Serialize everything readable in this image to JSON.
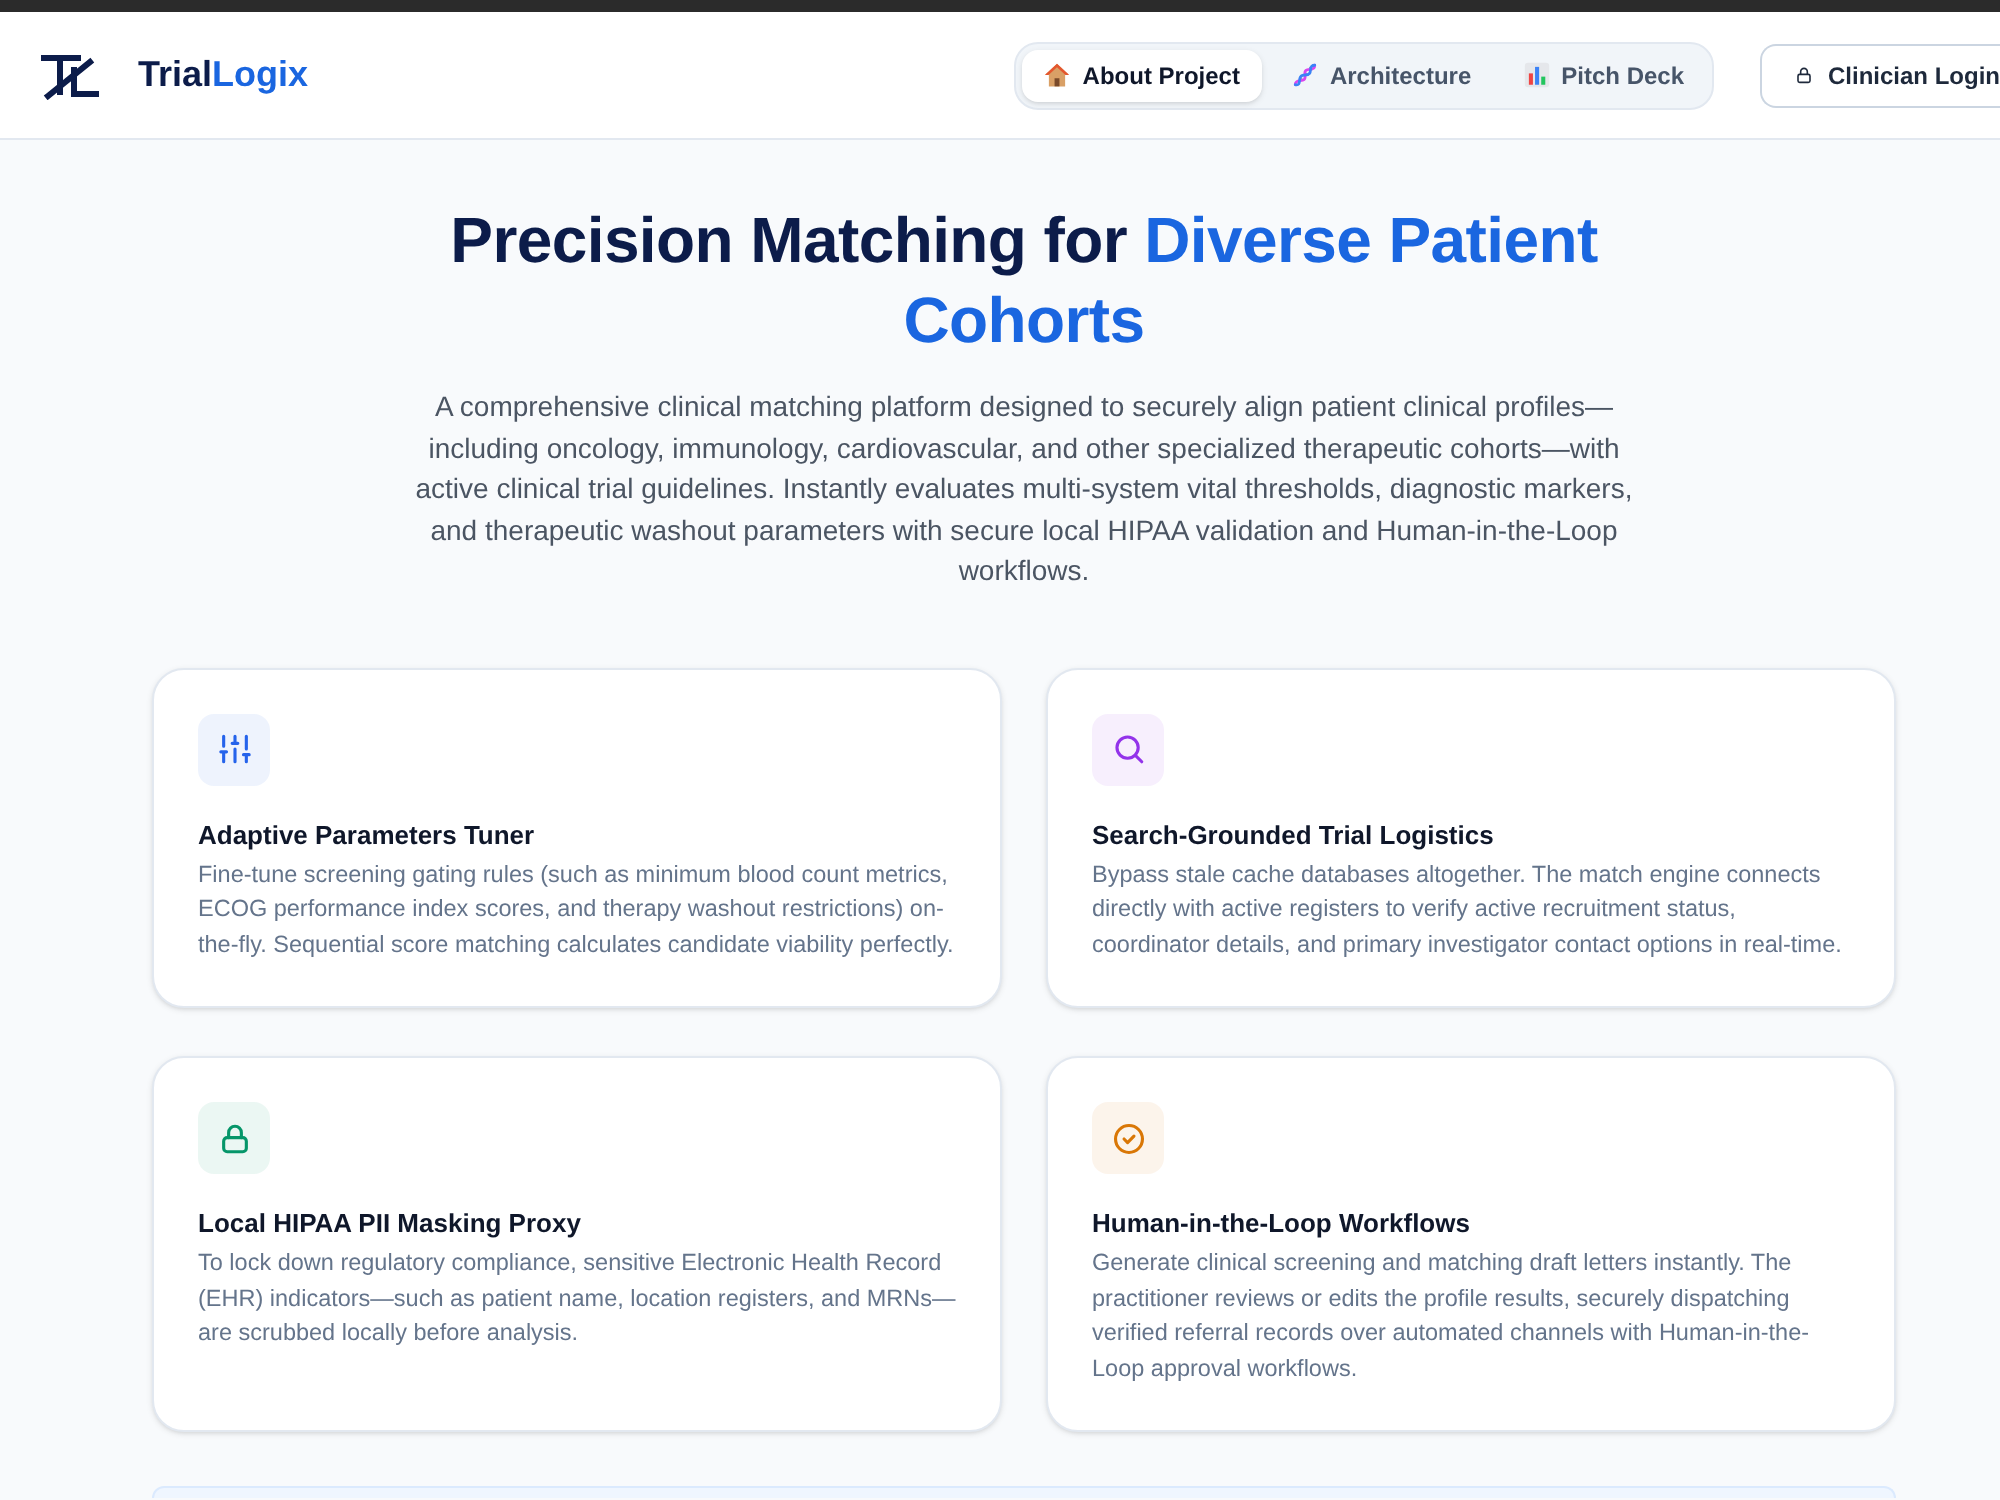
{
  "header": {
    "brand": {
      "text": "Trial",
      "highlight": "Logix"
    },
    "tabs": [
      {
        "label": "About Project",
        "selected": true,
        "kind": "home"
      },
      {
        "label": "Architecture",
        "selected": false,
        "kind": "dna"
      },
      {
        "label": "Pitch Deck",
        "selected": false,
        "kind": "chart"
      }
    ],
    "login_button": {
      "label": "Clinician Login"
    }
  },
  "hero": {
    "title": {
      "text": "Precision Matching for",
      "highlight": "Diverse Patient Cohorts"
    },
    "description": "A comprehensive clinical matching platform designed to securely align patient clinical profiles—including oncology, immunology, cardiovascular, and other specialized therapeutic cohorts—with active clinical trial guidelines. Instantly evaluates multi-system vital thresholds, diagnostic markers, and therapeutic washout parameters with secure local HIPAA validation and Human-in-the-Loop workflows."
  },
  "features": [
    {
      "kind": "tuner",
      "color": "#2563eb",
      "title": "Adaptive Parameters Tuner",
      "description": "Fine-tune screening gating rules (such as minimum blood count metrics, ECOG performance index scores, and therapy washout restrictions) on-the-fly. Sequential score matching calculates candidate viability perfectly."
    },
    {
      "kind": "search",
      "color": "#9333ea",
      "title": "Search-Grounded Trial Logistics",
      "description": "Bypass stale cache databases altogether. The match engine connects directly with active registers to verify active recruitment status, coordinator details, and primary investigator contact options in real-time."
    },
    {
      "kind": "lock",
      "color": "#059669",
      "title": "Local HIPAA PII Masking Proxy",
      "description": "To lock down regulatory compliance, sensitive Electronic Health Record (EHR) indicators—such as patient name, location registers, and MRNs—are scrubbed locally before analysis."
    },
    {
      "kind": "review",
      "color": "#d97706",
      "title": "Human-in-the-Loop Workflows",
      "description": "Generate clinical screening and matching draft letters instantly. The practitioner reviews or edits the profile results, securely dispatching verified referral records over automated channels with Human-in-the-Loop approval workflows."
    }
  ]
}
